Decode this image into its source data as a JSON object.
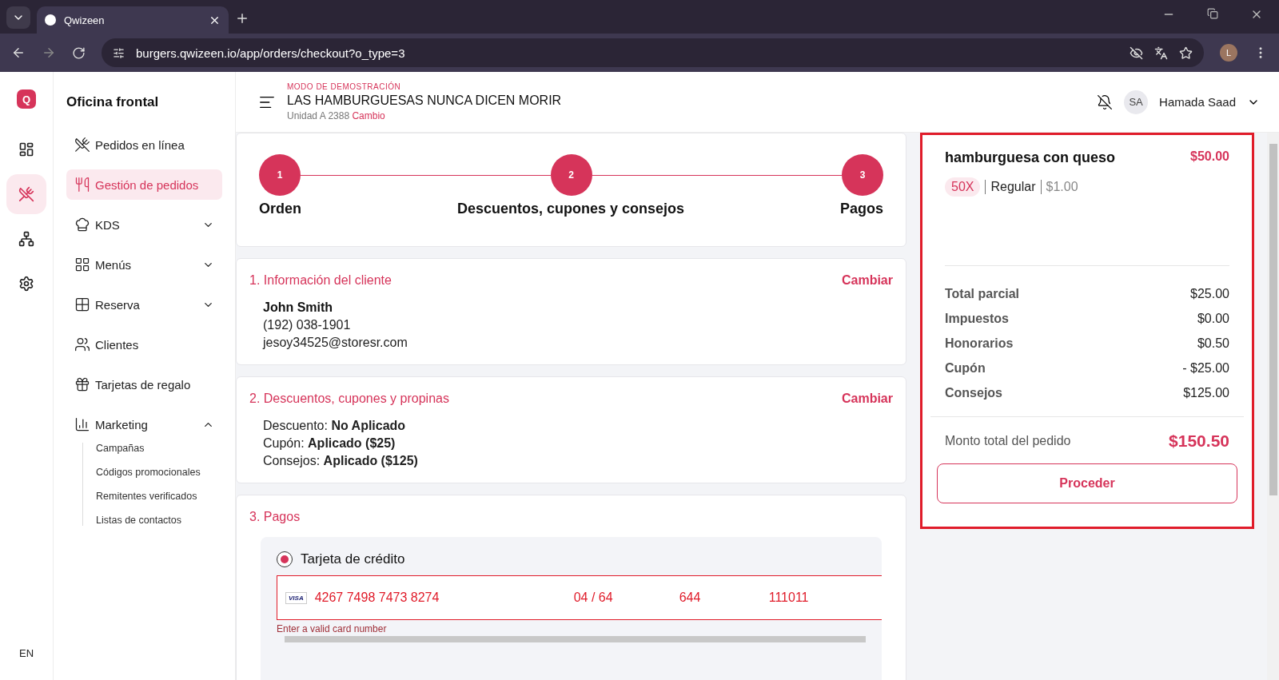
{
  "browser": {
    "tab_title": "Qwizeen",
    "url": "burgers.qwizeen.io/app/orders/checkout?o_type=3",
    "profile_initial": "L"
  },
  "rail": {
    "logo": "Q",
    "items": [
      {
        "selected": false
      },
      {
        "selected": true
      },
      {
        "selected": false
      },
      {
        "selected": false
      }
    ],
    "language": "EN"
  },
  "sidebar": {
    "title": "Oficina frontal",
    "items": [
      {
        "label": "Pedidos en línea",
        "selected": false
      },
      {
        "label": "Gestión de pedidos",
        "selected": true
      },
      {
        "label": "KDS",
        "selected": false,
        "expanded": false
      },
      {
        "label": "Menús",
        "selected": false,
        "expanded": false
      },
      {
        "label": "Reserva",
        "selected": false,
        "expanded": false
      },
      {
        "label": "Clientes",
        "selected": false
      },
      {
        "label": "Tarjetas de regalo",
        "selected": false
      },
      {
        "label": "Marketing",
        "selected": false,
        "expanded": true,
        "children": [
          {
            "label": "Campañas"
          },
          {
            "label": "Códigos promocionales"
          },
          {
            "label": "Remitentes verificados"
          },
          {
            "label": "Listas de contactos"
          }
        ]
      }
    ]
  },
  "header": {
    "demo_label": "MODO DE DEMOSTRACIÓN",
    "store_name": "LAS HAMBURGUESAS NUNCA DICEN MORIR",
    "unit": "Unidad A 2388",
    "change_link": "Cambio",
    "user_initials": "SA",
    "user_name": "Hamada Saad"
  },
  "steps": [
    {
      "number": "1",
      "label": "Orden"
    },
    {
      "number": "2",
      "label": "Descuentos, cupones y consejos"
    },
    {
      "number": "3",
      "label": "Pagos"
    }
  ],
  "customer": {
    "title": "1. Información del cliente",
    "action": "Cambiar",
    "name": "John Smith",
    "phone": "(192) 038-1901",
    "email": "jesoy34525@storesr.com"
  },
  "discounts": {
    "title": "2. Descuentos, cupones y propinas",
    "action": "Cambiar",
    "lines": [
      {
        "label": "Descuento:",
        "value": "No Aplicado"
      },
      {
        "label": "Cupón:",
        "value": "Aplicado ($25)"
      },
      {
        "label": "Consejos:",
        "value": "Aplicado ($125)"
      }
    ]
  },
  "payments": {
    "title": "3. Pagos",
    "method": {
      "label": "Tarjeta de crédito",
      "selected": true
    },
    "card": {
      "brand": "VISA",
      "number": "4267 7498 7473 8274",
      "expiry": "04 / 64",
      "cvc": "644",
      "zip": "111011"
    },
    "error": "Enter a valid card number"
  },
  "summary": {
    "item": {
      "name": "hamburguesa con queso",
      "price": "$50.00",
      "quantity": "50X",
      "size": "Regular",
      "unit_price": "$1.00"
    },
    "rows": [
      {
        "label": "Total parcial",
        "value": "$25.00"
      },
      {
        "label": "Impuestos",
        "value": "$0.00"
      },
      {
        "label": "Honorarios",
        "value": "$0.50"
      },
      {
        "label": "Cupón",
        "value": "- $25.00"
      },
      {
        "label": "Consejos",
        "value": "$125.00"
      }
    ],
    "total_label": "Monto total del pedido",
    "total": "$150.50",
    "button": "Proceder"
  }
}
